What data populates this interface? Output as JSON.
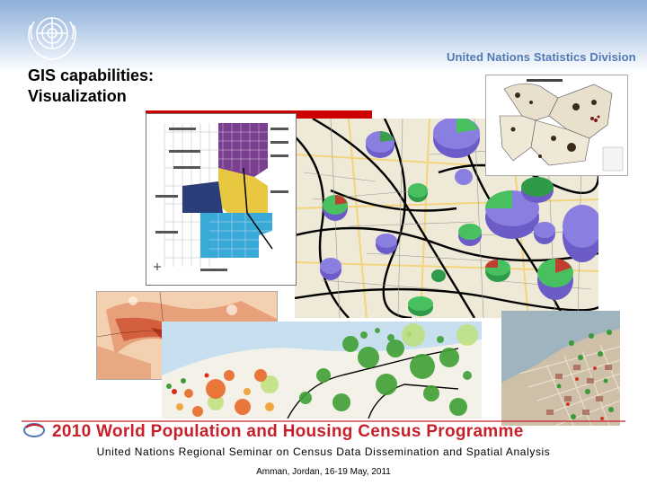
{
  "header": {
    "division": "United Nations Statistics Division",
    "title_line1": "GIS capabilities:",
    "title_line2": "Visualization"
  },
  "footer": {
    "programme_banner": "2010 World Population and Housing Census Programme",
    "seminar": "United Nations Regional Seminar on Census Data Dissemination and Spatial Analysis",
    "venue": "Amman, Jordan, 16-19 May, 2011"
  },
  "colors": {
    "header_blue": "#4f78b4",
    "accent_red": "#cc0000",
    "banner_red": "#c8202a"
  }
}
